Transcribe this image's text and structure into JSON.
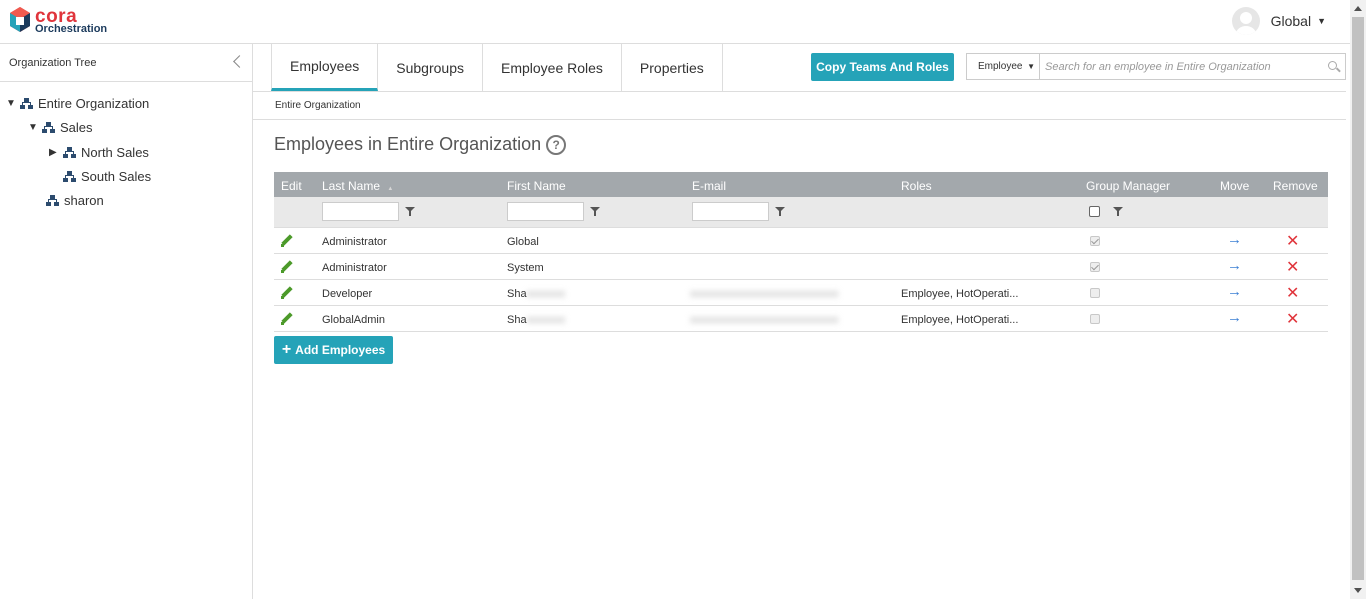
{
  "app": {
    "logo_top": "cora",
    "logo_bottom": "Orchestration"
  },
  "user": {
    "name": "Global",
    "caret": "▼"
  },
  "sidebar": {
    "title": "Organization Tree",
    "tree": [
      {
        "label": "Entire Organization",
        "expander": "▼"
      },
      {
        "label": "Sales",
        "expander": "▼"
      },
      {
        "label": "North Sales",
        "expander": "▶"
      },
      {
        "label": "South Sales",
        "expander": ""
      },
      {
        "label": "sharon",
        "expander": ""
      }
    ]
  },
  "tabs": [
    "Employees",
    "Subgroups",
    "Employee Roles",
    "Properties"
  ],
  "toolbar": {
    "copy_label": "Copy Teams And Roles"
  },
  "search": {
    "scope": "Employee",
    "placeholder": "Search for an employee in Entire Organization",
    "value": ""
  },
  "breadcrumb": "Entire Organization",
  "page": {
    "title": "Employees in Entire Organization",
    "help": "?"
  },
  "grid": {
    "headers": {
      "edit": "Edit",
      "last": "Last Name",
      "sort": "▲",
      "first": "First Name",
      "email": "E-mail",
      "roles": "Roles",
      "manager": "Group Manager",
      "move": "Move",
      "remove": "Remove"
    },
    "rows": [
      {
        "last": "Administrator",
        "first": "Global",
        "email": "",
        "roles": "",
        "manager": true
      },
      {
        "last": "Administrator",
        "first": "System",
        "email": "",
        "roles": "",
        "manager": true
      },
      {
        "last": "Developer",
        "first": "Sha",
        "email": "",
        "roles": "Employee, HotOperati...",
        "manager": false
      },
      {
        "last": "GlobalAdmin",
        "first": "Sha",
        "email": "",
        "roles": "Employee, HotOperati...",
        "manager": false
      }
    ],
    "move_icon": "→",
    "remove_icon": "✕"
  },
  "add_button": {
    "plus": "+",
    "label": "Add Employees"
  },
  "colors": {
    "accent": "#25a3b8",
    "brand_red": "#e0343b",
    "grid_header": "#a3a8ac",
    "edit_green": "#4c9a2a",
    "move_blue": "#3b7fd4"
  }
}
